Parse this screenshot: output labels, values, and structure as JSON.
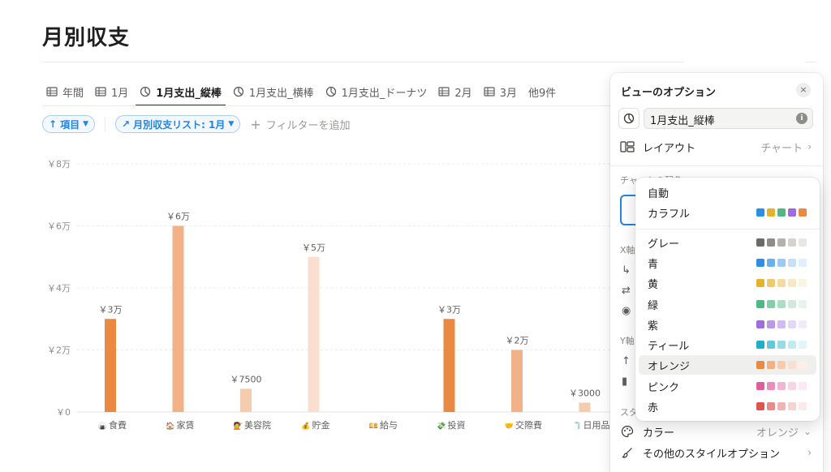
{
  "page": {
    "title": "月別収支"
  },
  "tabs": [
    {
      "label": "年間",
      "icon": "table-icon",
      "active": false
    },
    {
      "label": "1月",
      "icon": "table-icon",
      "active": false
    },
    {
      "label": "1月支出_縦棒",
      "icon": "chart-icon",
      "active": true
    },
    {
      "label": "1月支出_横棒",
      "icon": "chart-icon",
      "active": false
    },
    {
      "label": "1月支出_ドーナツ",
      "icon": "chart-icon",
      "active": false
    },
    {
      "label": "2月",
      "icon": "table-icon",
      "active": false
    },
    {
      "label": "3月",
      "icon": "table-icon",
      "active": false
    },
    {
      "label": "他9件",
      "icon": "",
      "active": false
    }
  ],
  "filters": {
    "sort_label": "項目",
    "relation_label": "月別収支リスト: 1月",
    "add_filter_label": "フィルターを追加"
  },
  "chart_data": {
    "type": "bar",
    "categories": [
      "食費",
      "家賃",
      "美容院",
      "貯金",
      "給与",
      "投資",
      "交際費",
      "日用品"
    ],
    "category_icons": [
      "🍙",
      "🏠",
      "💇",
      "💰",
      "💴",
      "💸",
      "🤝",
      "🧻"
    ],
    "values": [
      30000,
      60000,
      7500,
      50000,
      0,
      30000,
      20000,
      3000
    ],
    "data_labels": [
      "￥3万",
      "￥6万",
      "￥7500",
      "￥5万",
      "",
      "￥3万",
      "￥2万",
      "￥3000"
    ],
    "bar_colors": [
      "#ea8a42",
      "#f2b288",
      "#f5ccae",
      "#fadfd0",
      "#fadfd0",
      "#ea8a42",
      "#f2b288",
      "#f5ccae"
    ],
    "yticks": [
      0,
      20000,
      40000,
      60000,
      80000
    ],
    "ytick_labels": [
      "￥0",
      "￥2万",
      "￥4万",
      "￥6万",
      "￥8万"
    ],
    "ylim": [
      0,
      80000
    ],
    "grid": true,
    "title": "",
    "xlabel": "",
    "ylabel": ""
  },
  "panel": {
    "title": "ビューのオプション",
    "close_glyph": "×",
    "view_name": "1月支出_縦棒",
    "info_glyph": "i",
    "layout_label": "レイアウト",
    "layout_value": "チャート",
    "color_section_label": "チャートの配色",
    "x_axis_section": "X軸",
    "y_axis_section": "Y軸",
    "style_section": "スタイル",
    "color_label": "カラー",
    "color_value": "オレンジ",
    "more_style_label": "その他のスタイルオプション",
    "chevron": "›"
  },
  "color_menu": {
    "items": [
      {
        "label": "自動",
        "swatches": []
      },
      {
        "label": "カラフル",
        "swatches": [
          "#2b8fe3",
          "#e6b12c",
          "#4fb885",
          "#9e6be0",
          "#ea8a42"
        ]
      },
      {
        "label": "グレー",
        "swatches": [
          "#6b6a67",
          "#8e8d8a",
          "#b3b2af",
          "#d3d2cf",
          "#e8e7e5"
        ]
      },
      {
        "label": "青",
        "swatches": [
          "#2b8fe3",
          "#6ab0ec",
          "#9ccaf2",
          "#c4e0f7",
          "#e1eefb"
        ]
      },
      {
        "label": "黄",
        "swatches": [
          "#e6b12c",
          "#efca6d",
          "#f4dca0",
          "#f8e9c5",
          "#fbf4e3"
        ]
      },
      {
        "label": "緑",
        "swatches": [
          "#4fb885",
          "#84cfa8",
          "#acdec4",
          "#cfeadd",
          "#e6f4ed"
        ]
      },
      {
        "label": "紫",
        "swatches": [
          "#9e6be0",
          "#bb98e8",
          "#d2bbf0",
          "#e4d6f6",
          "#f1eafb"
        ]
      },
      {
        "label": "ティール",
        "swatches": [
          "#1fb0c9",
          "#62c8da",
          "#98dbe7",
          "#c2eaf1",
          "#e1f5f8"
        ]
      },
      {
        "label": "オレンジ",
        "swatches": [
          "#ea8a42",
          "#f2b288",
          "#f5ccae",
          "#fadfd0",
          "#fcefe6"
        ],
        "selected": true
      },
      {
        "label": "ピンク",
        "swatches": [
          "#e05d9c",
          "#ea8fbb",
          "#f1b6d2",
          "#f7d5e5",
          "#fbeaf2"
        ]
      },
      {
        "label": "赤",
        "swatches": [
          "#dd5451",
          "#e88c89",
          "#f0b4b2",
          "#f6d4d2",
          "#fbeae9"
        ]
      }
    ]
  }
}
